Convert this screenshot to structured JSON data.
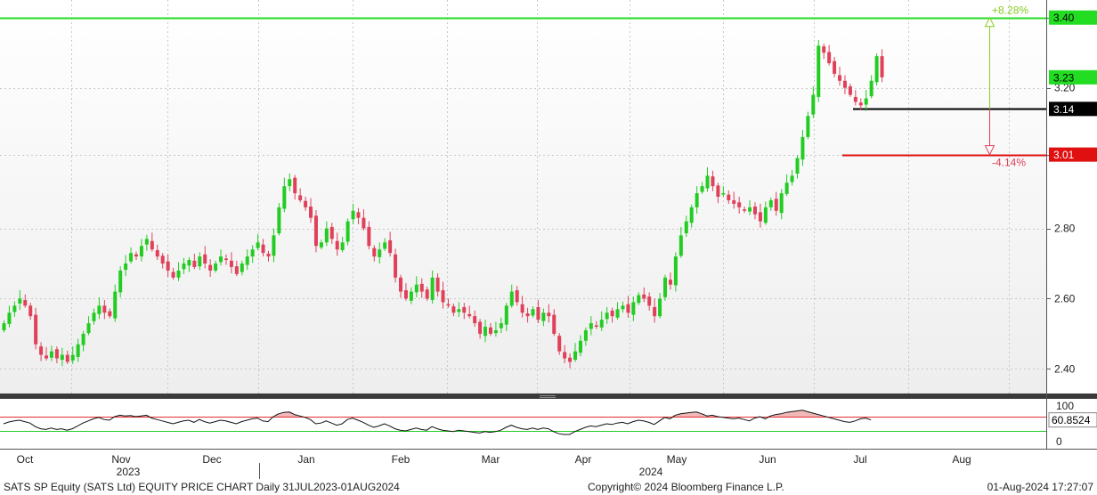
{
  "footer": {
    "left": "SATS SP Equity (SATS Ltd) EQUITY PRICE CHART  Daily 31JUL2023-01AUG2024",
    "middle": "Copyright© 2024 Bloomberg Finance L.P.",
    "right": "01-Aug-2024 17:27:07"
  },
  "colors": {
    "up": "#22cc22",
    "down": "#e0405a",
    "resistance": "#22dd22",
    "support_red": "#e01010",
    "support_black": "#000000",
    "rsi_line": "#111111",
    "rsi_overbought": "#e03030",
    "rsi_oversold": "#22cc22",
    "rsi_fill": "#f2b8b8"
  },
  "chart_data": [
    {
      "type": "candlestick",
      "ylim": [
        2.33,
        3.45
      ],
      "yticks": [
        "2.40",
        "2.60",
        "2.80",
        "3.01",
        "3.20",
        "3.40"
      ],
      "x_month_labels": [
        "Oct",
        "Nov",
        "Dec",
        "Jan",
        "Feb",
        "Mar",
        "Apr",
        "May",
        "Jun",
        "Jul",
        "Aug"
      ],
      "x_year_labels": [
        "2023",
        "2024"
      ],
      "price_badges": [
        {
          "label": "3.40",
          "value": 3.4,
          "color": "#22dd22"
        },
        {
          "label": "3.23",
          "value": 3.23,
          "color": "#22dd22"
        },
        {
          "label": "3.14",
          "value": 3.14,
          "color": "#000000"
        },
        {
          "label": "3.01",
          "value": 3.01,
          "color": "#e01010"
        }
      ],
      "horizontal_lines": [
        {
          "value": 3.4,
          "color": "#22dd22"
        },
        {
          "value": 3.14,
          "color": "#000000"
        },
        {
          "value": 3.01,
          "color": "#e01010"
        }
      ],
      "annotations": [
        {
          "text": "+8.28%",
          "from": 3.14,
          "to": 3.4,
          "color": "#88cc22"
        },
        {
          "text": "-4.14%",
          "from": 3.14,
          "to": 3.01,
          "color": "#e0405a"
        }
      ],
      "closes": [
        2.53,
        2.56,
        2.58,
        2.6,
        2.58,
        2.55,
        2.47,
        2.44,
        2.43,
        2.45,
        2.43,
        2.44,
        2.42,
        2.44,
        2.47,
        2.5,
        2.53,
        2.56,
        2.58,
        2.56,
        2.55,
        2.62,
        2.68,
        2.7,
        2.73,
        2.72,
        2.75,
        2.77,
        2.74,
        2.72,
        2.7,
        2.68,
        2.66,
        2.68,
        2.7,
        2.71,
        2.69,
        2.72,
        2.7,
        2.68,
        2.7,
        2.72,
        2.71,
        2.69,
        2.67,
        2.7,
        2.72,
        2.74,
        2.76,
        2.73,
        2.72,
        2.78,
        2.86,
        2.92,
        2.94,
        2.9,
        2.88,
        2.86,
        2.83,
        2.75,
        2.76,
        2.8,
        2.77,
        2.74,
        2.76,
        2.82,
        2.85,
        2.83,
        2.8,
        2.75,
        2.72,
        2.74,
        2.76,
        2.73,
        2.66,
        2.62,
        2.6,
        2.62,
        2.64,
        2.62,
        2.6,
        2.66,
        2.62,
        2.59,
        2.58,
        2.56,
        2.57,
        2.56,
        2.55,
        2.53,
        2.5,
        2.52,
        2.5,
        2.51,
        2.53,
        2.58,
        2.62,
        2.59,
        2.56,
        2.55,
        2.57,
        2.54,
        2.56,
        2.55,
        2.5,
        2.45,
        2.43,
        2.42,
        2.45,
        2.48,
        2.51,
        2.53,
        2.52,
        2.54,
        2.56,
        2.55,
        2.57,
        2.58,
        2.56,
        2.59,
        2.61,
        2.6,
        2.58,
        2.55,
        2.6,
        2.66,
        2.64,
        2.72,
        2.78,
        2.82,
        2.86,
        2.9,
        2.92,
        2.95,
        2.92,
        2.89,
        2.9,
        2.88,
        2.87,
        2.86,
        2.85,
        2.86,
        2.84,
        2.82,
        2.86,
        2.88,
        2.85,
        2.9,
        2.93,
        2.95,
        3.0,
        3.06,
        3.12,
        3.18,
        3.32,
        3.3,
        3.27,
        3.24,
        3.22,
        3.2,
        3.18,
        3.16,
        3.15,
        3.17,
        3.22,
        3.29,
        3.23
      ],
      "rsi": {
        "ylim": [
          0,
          100
        ],
        "yticks": [
          "100",
          "0"
        ],
        "overbought": 70,
        "oversold": 30,
        "last_label": "60.8524",
        "last_value": 60.85,
        "values": [
          50,
          55,
          58,
          60,
          56,
          52,
          42,
          36,
          34,
          38,
          34,
          36,
          32,
          36,
          44,
          52,
          58,
          64,
          68,
          62,
          60,
          70,
          74,
          72,
          73,
          70,
          72,
          74,
          66,
          62,
          58,
          54,
          50,
          54,
          58,
          60,
          54,
          62,
          56,
          52,
          56,
          60,
          58,
          54,
          50,
          56,
          60,
          64,
          66,
          58,
          56,
          70,
          78,
          82,
          83,
          76,
          72,
          68,
          62,
          50,
          52,
          58,
          52,
          46,
          50,
          62,
          66,
          60,
          54,
          46,
          40,
          44,
          50,
          44,
          36,
          32,
          30,
          34,
          38,
          34,
          32,
          42,
          36,
          32,
          30,
          28,
          32,
          30,
          28,
          26,
          24,
          28,
          26,
          28,
          32,
          40,
          46,
          40,
          36,
          34,
          38,
          34,
          38,
          36,
          28,
          22,
          20,
          20,
          28,
          34,
          40,
          44,
          42,
          46,
          50,
          48,
          52,
          54,
          50,
          56,
          60,
          58,
          54,
          48,
          58,
          68,
          64,
          74,
          78,
          80,
          82,
          83,
          78,
          72,
          74,
          70,
          68,
          66,
          64,
          66,
          62,
          58,
          66,
          70,
          64,
          72,
          76,
          78,
          82,
          84,
          86,
          88,
          84,
          80,
          76,
          72,
          68,
          64,
          60,
          56,
          54,
          58,
          64,
          66,
          60.85
        ]
      }
    }
  ]
}
